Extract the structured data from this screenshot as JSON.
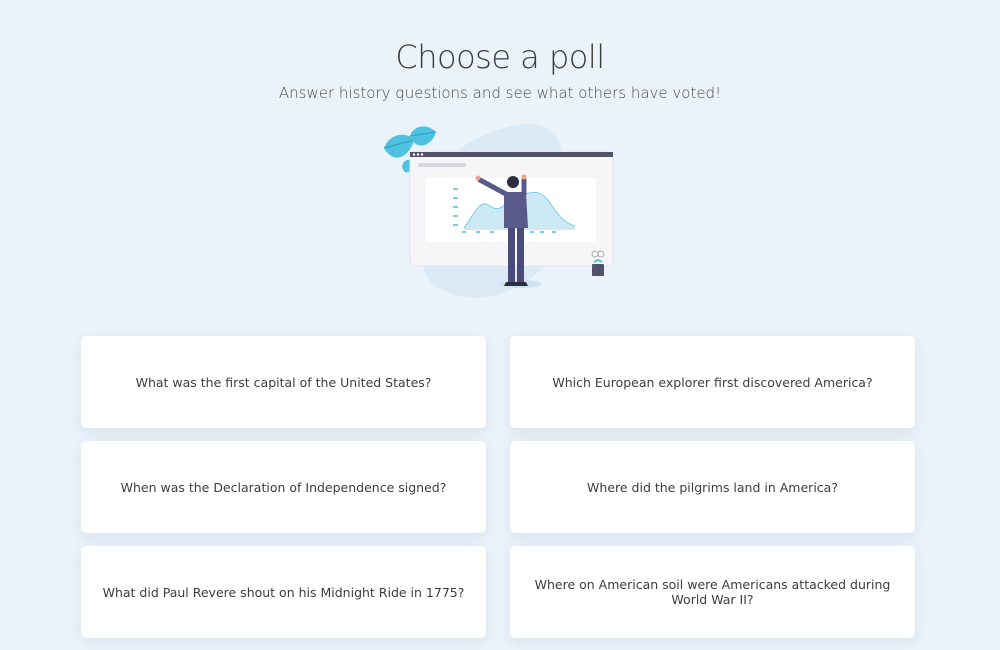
{
  "header": {
    "title": "Choose a poll",
    "subtitle": "Answer history questions and see what others have voted!"
  },
  "illustration": {
    "name": "presentation-illustration",
    "colors": {
      "leaf": "#4fc1e1",
      "blob": "#dbeaf5",
      "board_bar": "#54516b",
      "suit": "#4c4c7a",
      "chart_fill": "#bfe3f1"
    }
  },
  "polls": [
    {
      "question": "What was the first capital of the United States?"
    },
    {
      "question": "Which European explorer first discovered America?"
    },
    {
      "question": "When was the Declaration of Independence signed?"
    },
    {
      "question": "Where did the pilgrims land in America?"
    },
    {
      "question": "What did Paul Revere shout on his Midnight Ride in 1775?"
    },
    {
      "question": "Where on American soil were Americans attacked during World War II?"
    }
  ]
}
